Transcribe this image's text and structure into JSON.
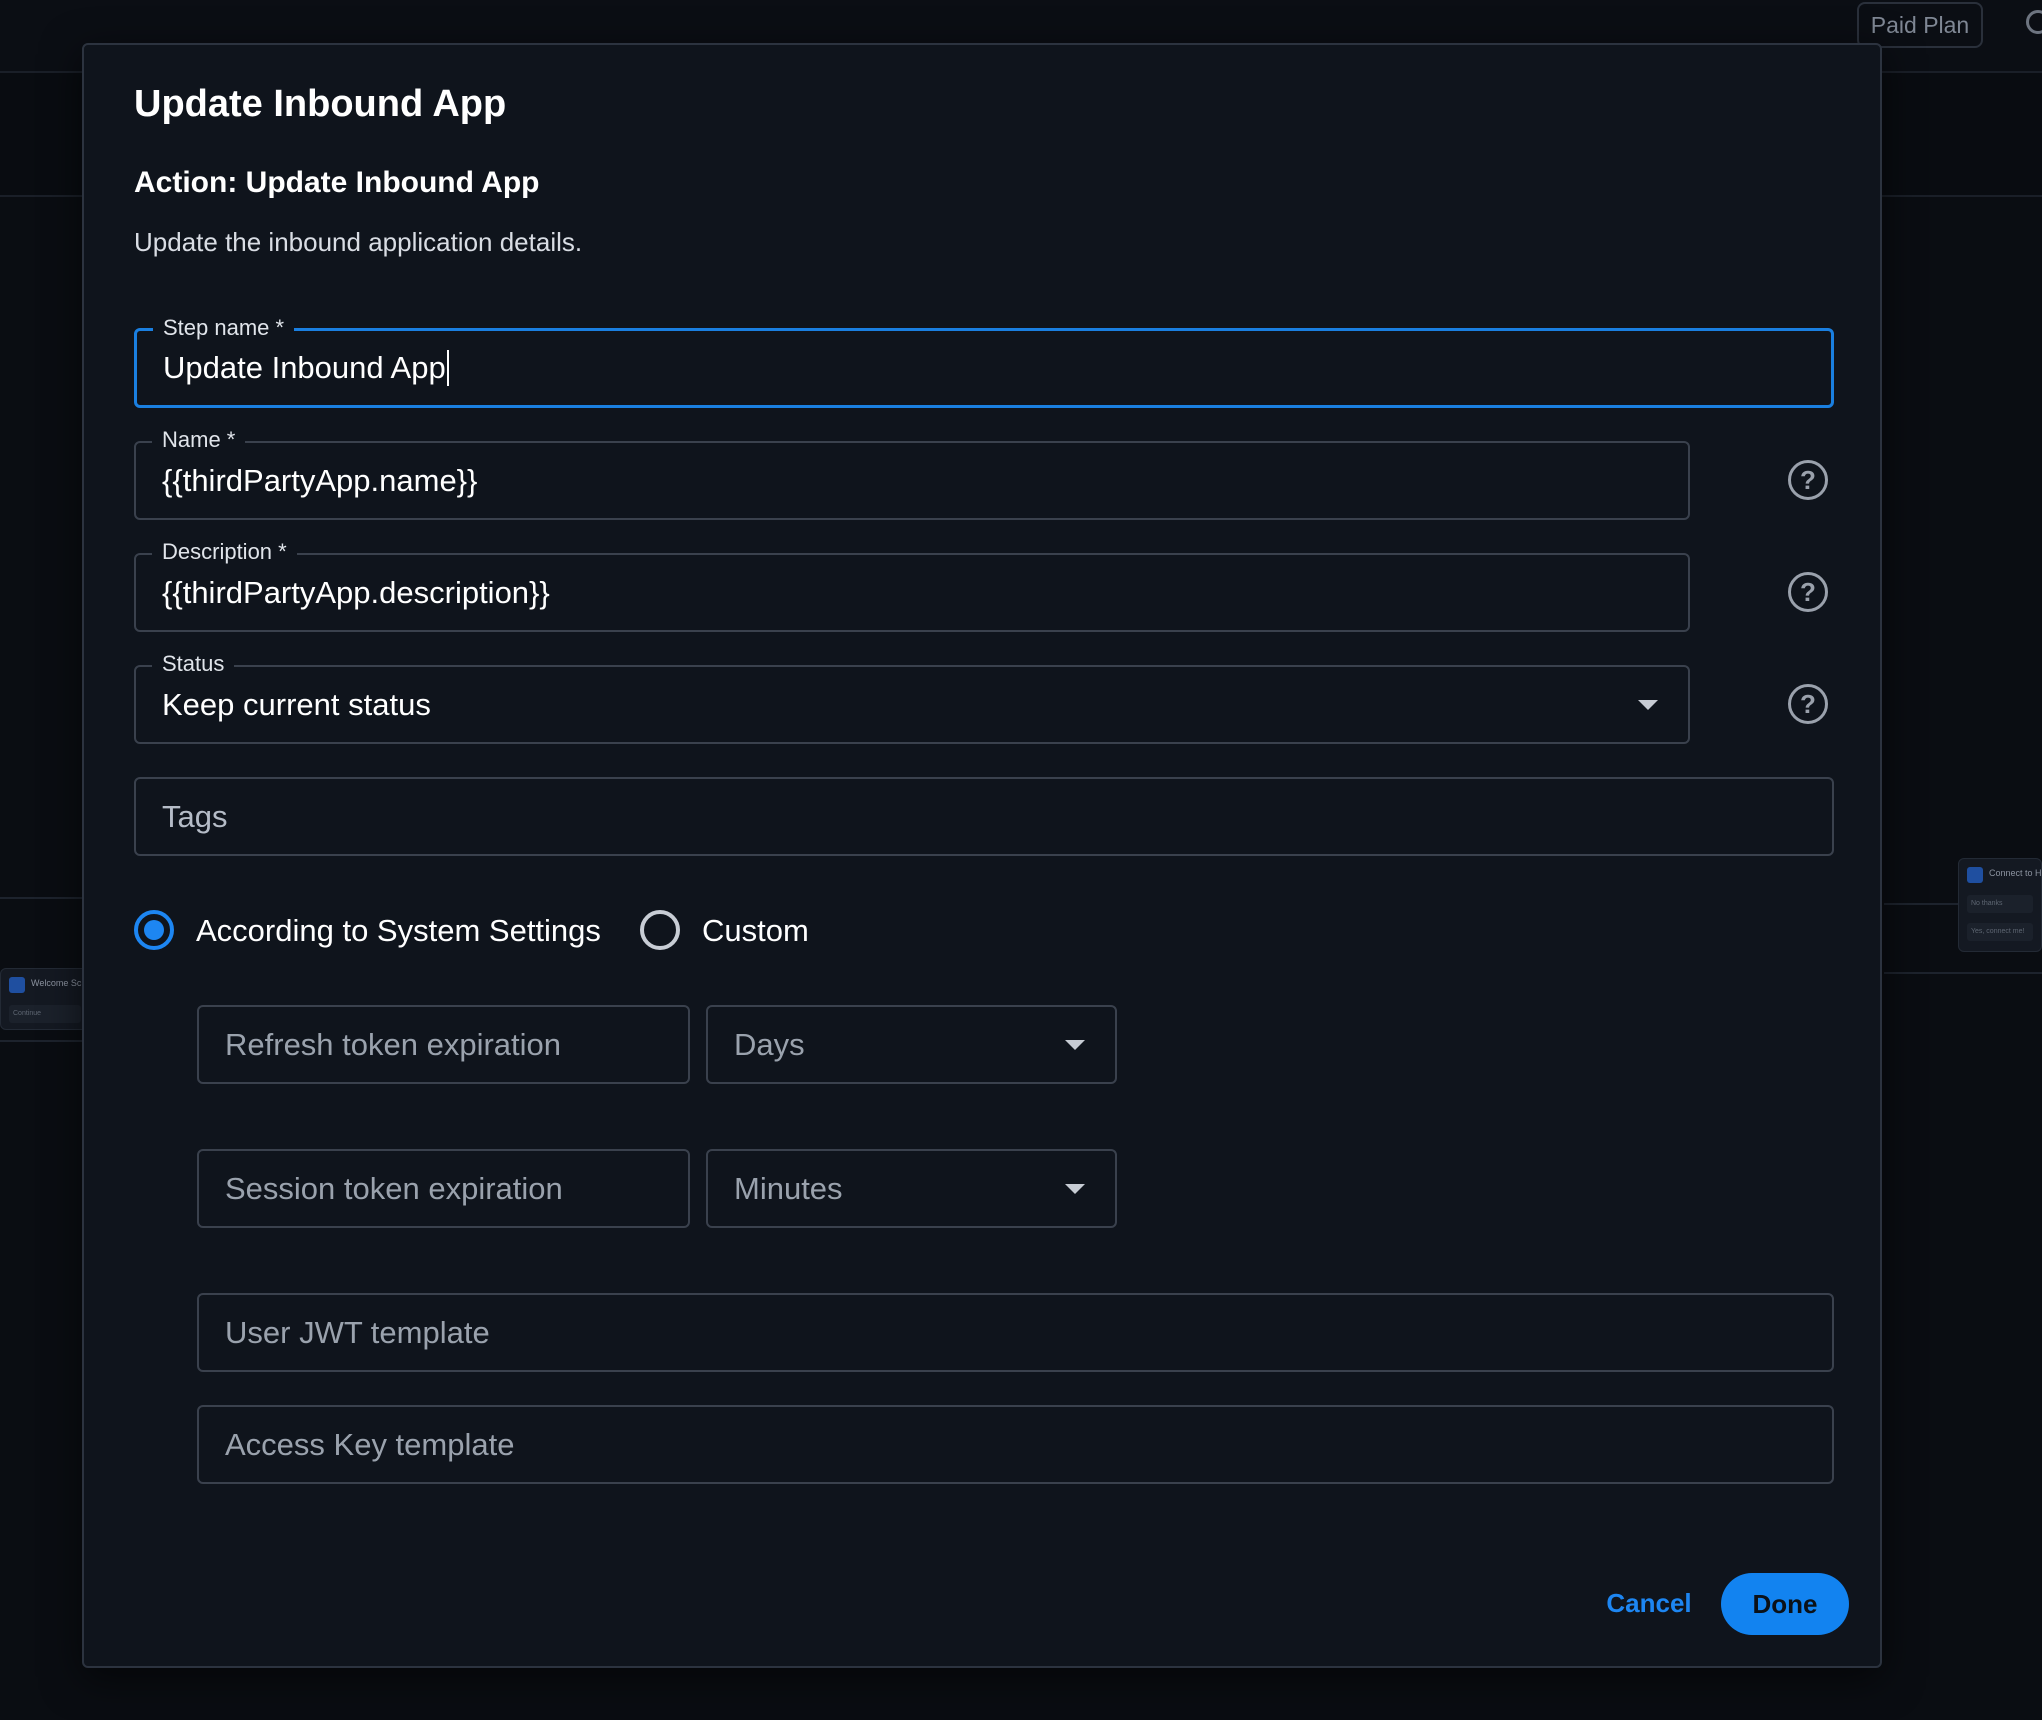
{
  "background": {
    "plan_badge": "Paid Plan",
    "node_left": {
      "title": "Welcome Sc",
      "row": "Continue"
    },
    "node_right": {
      "title": "Connect to H",
      "rows": [
        "No thanks",
        "Yes, connect me!"
      ]
    }
  },
  "modal": {
    "title": "Update Inbound App",
    "action_title": "Action: Update Inbound App",
    "description": "Update the inbound application details.",
    "fields": {
      "step_name": {
        "label": "Step name *",
        "value": "Update Inbound App"
      },
      "name": {
        "label": "Name *",
        "value": "{{thirdPartyApp.name}}"
      },
      "description": {
        "label": "Description *",
        "value": "{{thirdPartyApp.description}}"
      },
      "status": {
        "label": "Status",
        "value": "Keep current status"
      },
      "tags": {
        "placeholder": "Tags"
      }
    },
    "radio": {
      "option_system": "According to System Settings",
      "option_custom": "Custom",
      "selected": "According to System Settings"
    },
    "token": {
      "refresh_placeholder": "Refresh token expiration",
      "refresh_unit": "Days",
      "session_placeholder": "Session token expiration",
      "session_unit": "Minutes",
      "jwt_placeholder": "User JWT template",
      "access_key_placeholder": "Access Key template"
    },
    "buttons": {
      "cancel": "Cancel",
      "done": "Done"
    },
    "help_glyph": "?"
  },
  "colors": {
    "accent": "#1283f0",
    "modal_bg": "#0f141c",
    "border": "#3a414d"
  }
}
